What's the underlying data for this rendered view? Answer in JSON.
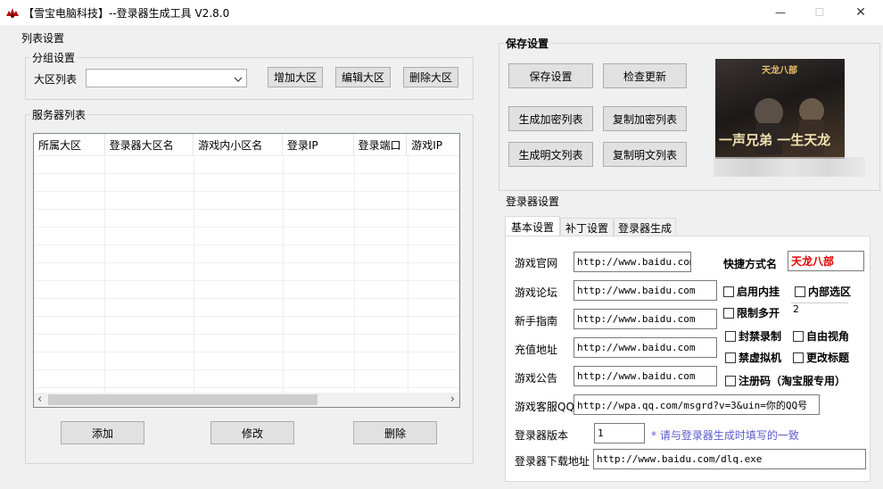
{
  "window": {
    "title": "【雪宝电脑科技】--登录器生成工具 V2.8.0",
    "minimize": "—",
    "maximize": "☐",
    "close": "✕"
  },
  "list_settings": {
    "title": "列表设置",
    "group": {
      "title": "分组设置",
      "region_label": "大区列表",
      "region_value": "",
      "add_btn": "增加大区",
      "edit_btn": "编辑大区",
      "delete_btn": "删除大区"
    },
    "servers": {
      "title": "服务器列表",
      "columns": [
        "所属大区",
        "登录器大区名",
        "游戏内小区名",
        "登录IP",
        "登录端口",
        "游戏IP"
      ],
      "scroll_left": "‹",
      "scroll_right": "›"
    },
    "add_btn": "添加",
    "modify_btn": "修改",
    "delete_btn": "删除"
  },
  "save_settings": {
    "title": "保存设置",
    "save_btn": "保存设置",
    "check_update_btn": "检查更新",
    "gen_encrypted_btn": "生成加密列表",
    "copy_encrypted_btn": "复制加密列表",
    "gen_plain_btn": "生成明文列表",
    "copy_plain_btn": "复制明文列表"
  },
  "banner": {
    "logo_text": "天龙八部",
    "slogan": "一声兄弟 一生天龙"
  },
  "launcher_settings": {
    "title": "登录器设置",
    "tabs": [
      "基本设置",
      "补丁设置",
      "登录器生成"
    ],
    "fields": {
      "official_label": "游戏官网",
      "official_value": "http://www.baidu.com",
      "forum_label": "游戏论坛",
      "forum_value": "http://www.baidu.com",
      "guide_label": "新手指南",
      "guide_value": "http://www.baidu.com",
      "recharge_label": "充值地址",
      "recharge_value": "http://www.baidu.com",
      "notice_label": "游戏公告",
      "notice_value": "http://www.baidu.com",
      "service_label": "游戏客服QQ",
      "service_value": "http://wpa.qq.com/msgrd?v=3&uin=你的QQ号",
      "version_label": "登录器版本",
      "version_value": "1",
      "version_hint": "* 请与登录器生成时填写的一致",
      "download_label": "登录器下载地址",
      "download_value": "http://www.baidu.com/dlq.exe",
      "shortcut_label": "快捷方式名",
      "shortcut_value": "天龙八部",
      "multi_count": "2"
    },
    "checks": {
      "plugin": "启用内挂",
      "inner_select": "内部选区",
      "limit_multi": "限制多开",
      "block_record": "封禁录制",
      "free_view": "自由视角",
      "block_vm": "禁虚拟机",
      "change_title": "更改标题",
      "reg_code": "注册码（淘宝服专用）"
    },
    "colors": {
      "shortcut_text": "#e00000",
      "hint_text": "#5a5acd"
    }
  }
}
